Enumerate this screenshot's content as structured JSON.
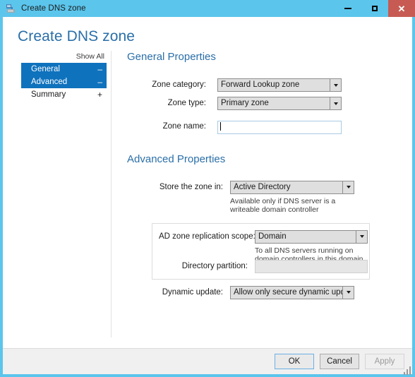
{
  "window": {
    "title": "Create DNS zone",
    "icon": "dns-zone-icon",
    "controls": {
      "minimize": "minimize-icon",
      "maximize": "maximize-icon",
      "close": "close-icon"
    },
    "accent_color": "#5bc5ec",
    "close_color": "#c75b53"
  },
  "page": {
    "title": "Create DNS zone"
  },
  "nav": {
    "show_all": "Show All",
    "items": [
      {
        "label": "General",
        "expander": "–",
        "selected": true
      },
      {
        "label": "Advanced",
        "expander": "–",
        "selected": true
      },
      {
        "label": "Summary",
        "expander": "+",
        "selected": false
      }
    ],
    "selected_color": "#0f72bd"
  },
  "general": {
    "heading": "General Properties",
    "zone_category": {
      "label": "Zone category:",
      "value": "Forward Lookup zone"
    },
    "zone_type": {
      "label": "Zone type:",
      "value": "Primary zone"
    },
    "zone_name": {
      "label": "Zone name:",
      "value": "",
      "placeholder": ""
    }
  },
  "advanced": {
    "heading": "Advanced Properties",
    "store_zone_in": {
      "label": "Store the zone in:",
      "value": "Active Directory",
      "hint": "Available only if DNS server is a writeable domain controller"
    },
    "ad_replication_scope": {
      "label": "AD zone replication scope:",
      "value": "Domain",
      "hint": "To all DNS servers running on domain controllers in this domain"
    },
    "directory_partition": {
      "label": "Directory partition:",
      "value": "",
      "placeholder": ""
    },
    "dynamic_update": {
      "label": "Dynamic update:",
      "value": "Allow only secure dynamic updates (rec"
    }
  },
  "footer": {
    "ok": "OK",
    "cancel": "Cancel",
    "apply": "Apply"
  }
}
